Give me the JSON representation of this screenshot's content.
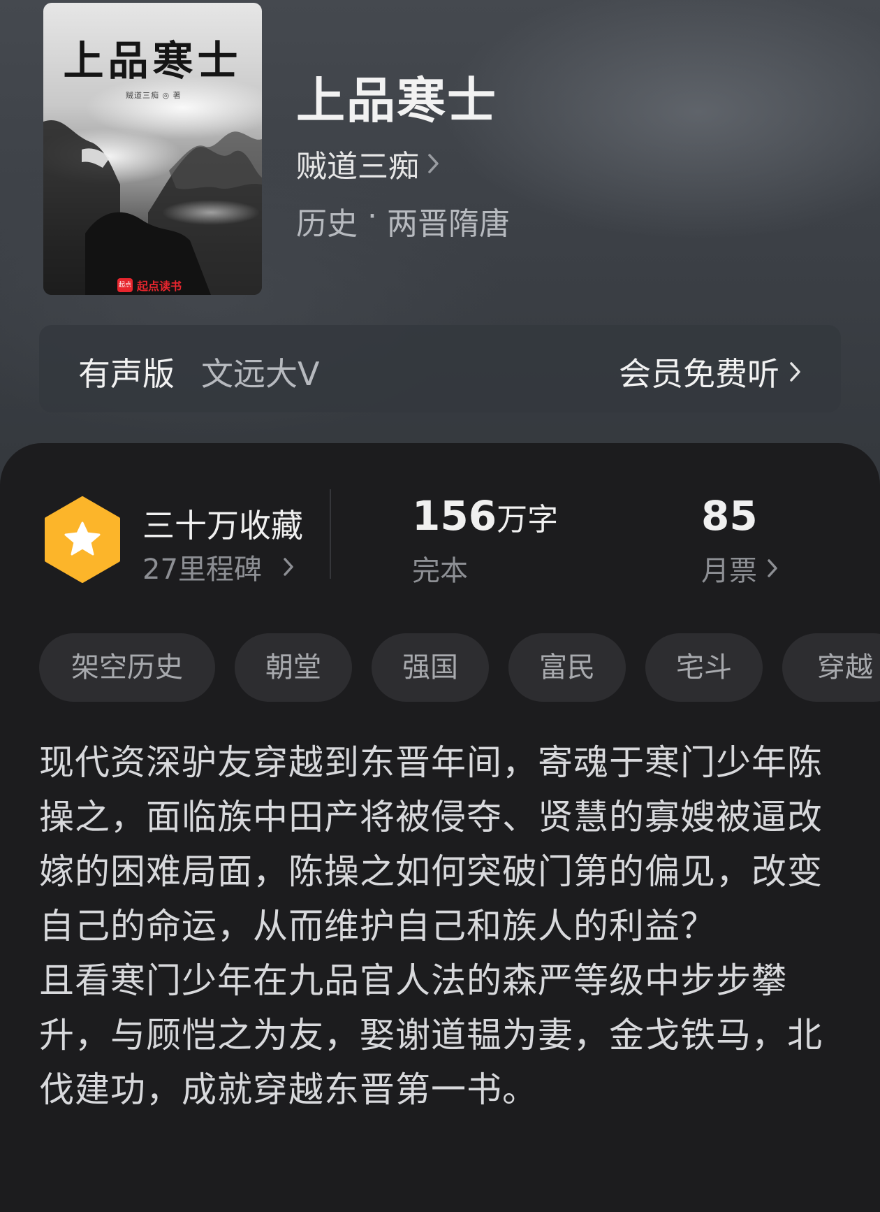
{
  "book": {
    "title": "上品寒士",
    "author": "贼道三痴",
    "category": "历史",
    "separator": "·",
    "subcategory": "两晋隋唐",
    "cover": {
      "title": "上品寒士",
      "author_line": "贼道三痴 ◎ 著",
      "publisher_badge": "起点",
      "publisher": "起点读书"
    }
  },
  "audio": {
    "label": "有声版",
    "narrator": "文远大V",
    "action": "会员免费听"
  },
  "stats": {
    "collections": "三十万收藏",
    "milestones": "27里程碑",
    "words_num": "156",
    "words_unit": "万字",
    "status": "完本",
    "monthly_tickets": "85",
    "monthly_tickets_label": "月票"
  },
  "tags": [
    "架空历史",
    "朝堂",
    "强国",
    "富民",
    "宅斗",
    "穿越"
  ],
  "synopsis": "现代资深驴友穿越到东晋年间，寄魂于寒门少年陈操之，面临族中田产将被侵夺、贤慧的寡嫂被逼改嫁的困难局面，陈操之如何突破门第的偏见，改变自己的命运，从而维护自己和族人的利益？\n且看寒门少年在九品官人法的森严等级中步步攀升，与顾恺之为友，娶谢道韫为妻，金戈铁马，北伐建功，成就穿越东晋第一书。",
  "colors": {
    "badge_fill": "#fcb52a",
    "panel_bg": "#1c1c1e",
    "header_bg": "#3f4349",
    "brand_red": "#e8262e"
  },
  "icons": [
    "chevron-right-icon",
    "star-badge-icon"
  ]
}
